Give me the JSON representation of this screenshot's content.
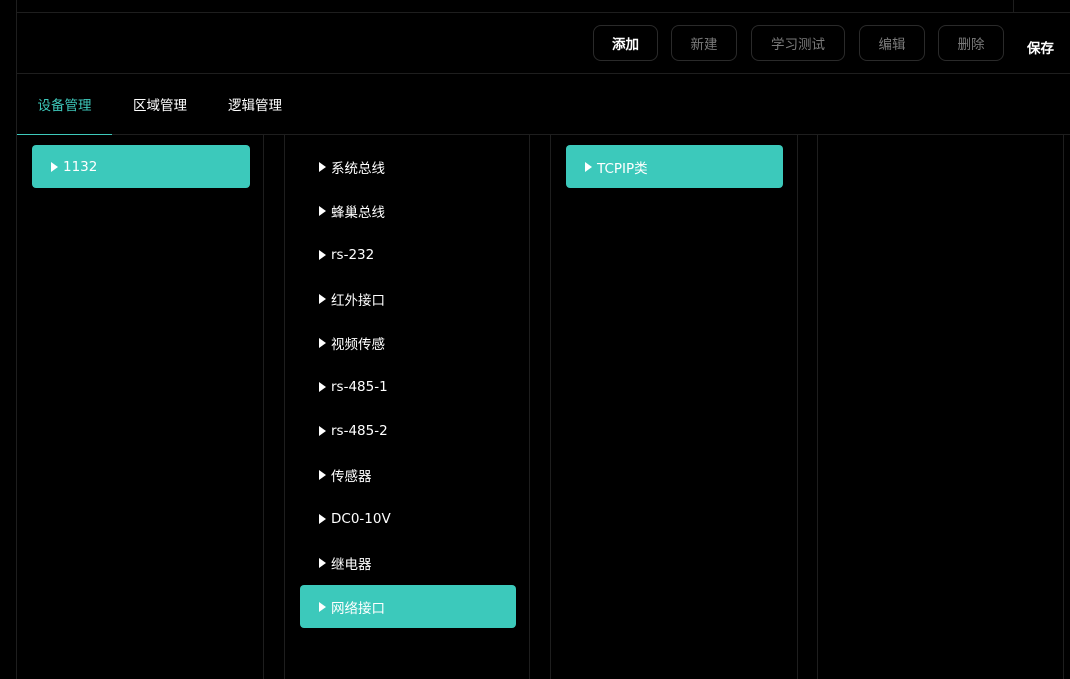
{
  "toolbar": {
    "buttons": [
      {
        "label": "添加",
        "enabled": true
      },
      {
        "label": "新建",
        "enabled": false
      },
      {
        "label": "学习测试",
        "enabled": false
      },
      {
        "label": "编辑",
        "enabled": false
      },
      {
        "label": "删除",
        "enabled": false
      }
    ],
    "save_label": "保存"
  },
  "tabs": [
    {
      "label": "设备管理",
      "active": true
    },
    {
      "label": "区域管理",
      "active": false
    },
    {
      "label": "逻辑管理",
      "active": false
    }
  ],
  "column1": {
    "items": [
      {
        "label": "1132",
        "selected": true
      }
    ]
  },
  "column2": {
    "items": [
      {
        "label": "系统总线",
        "selected": false
      },
      {
        "label": "蜂巢总线",
        "selected": false
      },
      {
        "label": "rs-232",
        "selected": false
      },
      {
        "label": "红外接口",
        "selected": false
      },
      {
        "label": "视频传感",
        "selected": false
      },
      {
        "label": "rs-485-1",
        "selected": false
      },
      {
        "label": "rs-485-2",
        "selected": false
      },
      {
        "label": "传感器",
        "selected": false
      },
      {
        "label": "DC0-10V",
        "selected": false
      },
      {
        "label": "继电器",
        "selected": false
      },
      {
        "label": "网络接口",
        "selected": true
      }
    ]
  },
  "column3": {
    "items": [
      {
        "label": "TCPIP类",
        "selected": true
      }
    ]
  },
  "colors": {
    "accent": "#3ec9bb",
    "selected_bg": "#3cc9bb",
    "background": "#000000",
    "border": "#1e1e1e"
  }
}
